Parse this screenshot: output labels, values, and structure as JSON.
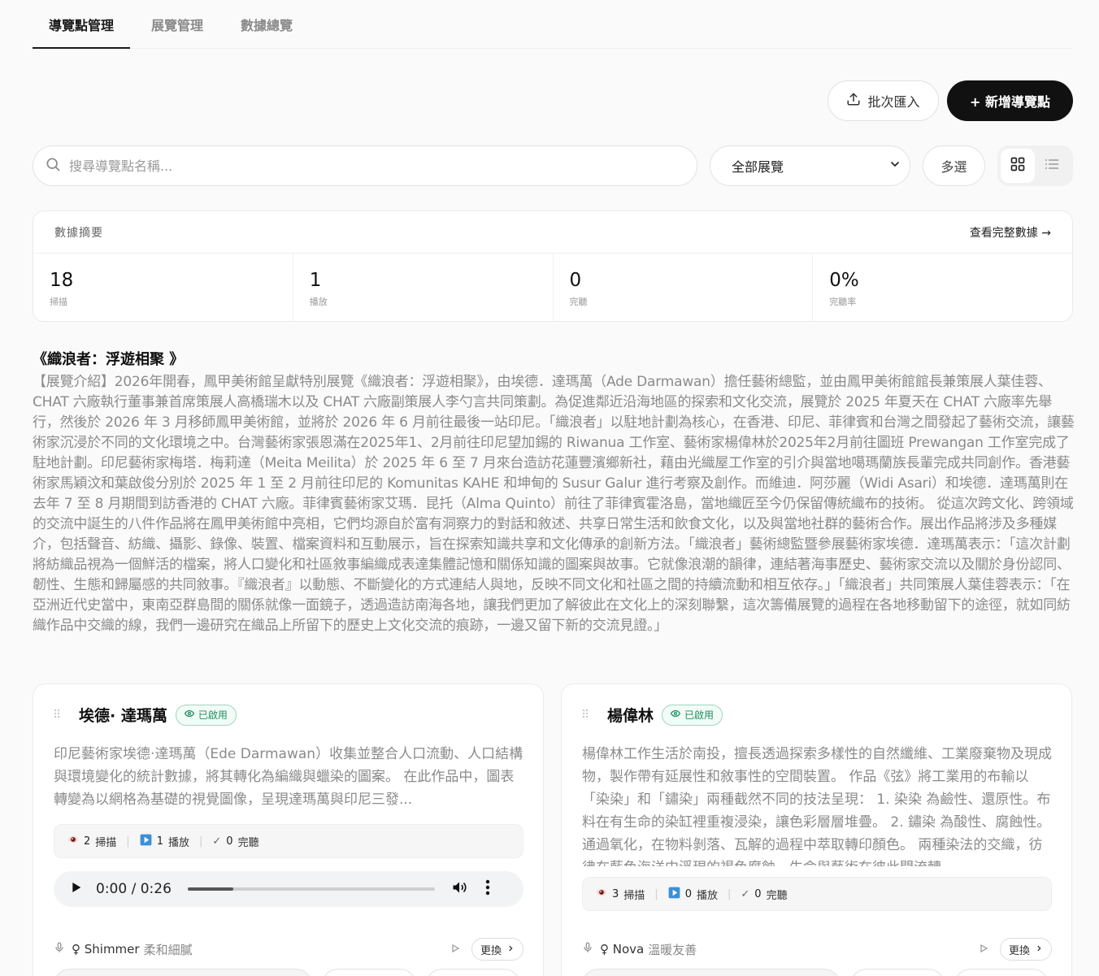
{
  "tabs": [
    {
      "label": "導覽點管理",
      "active": true
    },
    {
      "label": "展覽管理",
      "active": false
    },
    {
      "label": "數據總覽",
      "active": false
    }
  ],
  "actions": {
    "import_label": "批次匯入",
    "add_label": "+ 新增導覽點"
  },
  "filters": {
    "search_placeholder": "搜尋導覽點名稱...",
    "exhibition_select": "全部展覽",
    "multi_label": "多選",
    "view_mode": "grid"
  },
  "summary": {
    "title": "數據摘要",
    "link": "查看完整數據 →",
    "stats": [
      {
        "value": "18",
        "label": "掃描"
      },
      {
        "value": "1",
        "label": "播放"
      },
      {
        "value": "0",
        "label": "完聽"
      },
      {
        "value": "0%",
        "label": "完聽率"
      }
    ]
  },
  "exhibition": {
    "title": "《織浪者：浮遊相聚 》",
    "description": "【展覽介紹】2026年開春，鳳甲美術館呈獻特別展覽《織浪者：浮遊相聚》，由埃德．達瑪萬（Ade Darmawan）擔任藝術總監，並由鳳甲美術館館長兼策展人葉佳蓉、CHAT 六廠執行董事兼首席策展人高橋瑞木以及 CHAT 六廠副策展人李勺言共同策劃。為促進鄰近沿海地區的探索和文化交流，展覽於 2025 年夏天在 CHAT 六廠率先舉行，然後於 2026 年 3 月移師鳳甲美術館，並將於 2026 年 6 月前往最後一站印尼。「織浪者」以駐地計劃為核心，在香港、印尼、菲律賓和台灣之間發起了藝術交流，讓藝術家沉浸於不同的文化環境之中。台灣藝術家張恩滿在2025年1、2月前往印尼望加錫的 Riwanua 工作室、藝術家楊偉林於2025年2月前往圖班 Prewangan 工作室完成了駐地計劃。印尼藝術家梅塔．梅莉達（Meita Meilita）於 2025 年 6 至 7 月來台造訪花蓮豐濱鄉新社，藉由光織屋工作室的引介與當地噶瑪蘭族長輩完成共同創作。香港藝術家馬穎汶和葉啟俊分別於 2025 年 1 至 2 月前往印尼的 Komunitas KAHE 和坤甸的 Susur Galur 進行考察及創作。而維迪．阿莎麗（Widi Asari）和埃德．達瑪萬則在去年 7 至 8 月期間到訪香港的 CHAT 六廠。菲律賓藝術家艾瑪．昆托（Alma Quinto）前往了菲律賓霍洛島，當地織匠至今仍保留傳統織布的技術。 從這次跨文化、跨領域的交流中誕生的八件作品將在鳳甲美術館中亮相，它們均源自於富有洞察力的對話和敘述、共享日常生活和飲食文化，以及與當地社群的藝術合作。展出作品將涉及多種媒介，包括聲音、紡織、攝影、錄像、裝置、檔案資料和互動展示，旨在探索知識共享和文化傳承的創新方法。「織浪者」藝術總監暨參展藝術家埃德．達瑪萬表示：「這次計劃將紡織品視為一個鮮活的檔案，將人口變化和社區敘事編織成表達集體記憶和關係知識的圖案與故事。它就像浪潮的韻律，連結著海事歷史、藝術家交流以及關於身份認同、韌性、生態和歸屬感的共同敘事。『織浪者』以動態、不斷變化的方式連結人與地，反映不同文化和社區之間的持續流動和相互依存。」「織浪者」共同策展人葉佳蓉表示：「在亞洲近代史當中，東南亞群島間的關係就像一面鏡子，透過造訪南海各地，讓我們更加了解彼此在文化上的深刻聯繫，這次籌備展覽的過程在各地移動留下的途徑，就如同紡織作品中交織的線，我們一邊研究在織品上所留下的歷史上文化交流的痕跡，一邊又留下新的交流見證。」"
  },
  "cards": [
    {
      "name": "埃德· 達瑪萬",
      "status": "已啟用",
      "description": "印尼藝術家埃德·達瑪萬（Ede Darmawan）收集並整合人口流動、人口結構與環境變化的統計數據，將其轉化為編織與蠟染的圖案。 在此作品中，圖表轉變為以網格為基礎的視覺圖像，呈現達瑪萬與印尼三發...",
      "scans": "2",
      "scans_label": "掃描",
      "plays": "1",
      "plays_label": "播放",
      "completes": "0",
      "completes_label": "完聽",
      "audio_time": "0:00 / 0:26",
      "audio_progress": 0.0,
      "voice_name": "♀ Shimmer",
      "voice_desc": "柔和細膩",
      "change_label": "更換"
    },
    {
      "name": "楊偉林",
      "status": "已啟用",
      "description": "楊偉林工作生活於南投，擅長透過探索多樣性的自然纖維、工業廢棄物及現成物，製作帶有延展性和敘事性的空間裝置。 作品《弦》將工業用的布輸以「染染」和「鏽染」兩種截然不同的技法呈現： 1. 染染 為鹼性、還原性。布料在有生命的染缸裡重複浸染，讓色彩層層堆疊。 2. 鏽染 為酸性、腐蝕性。通過氧化，在物料剝落、瓦解的過程中萃取轉印顏色。 兩種染法的交織，彷彿在藍色海洋中浮現的褐色腐蝕，生命與藝術在彼此間流轉。",
      "scans": "3",
      "scans_label": "掃描",
      "plays": "0",
      "plays_label": "播放",
      "completes": "0",
      "completes_label": "完聽",
      "voice_name": "♀ Nova",
      "voice_desc": "溫暖友善",
      "change_label": "更換"
    }
  ],
  "colors": {
    "accent": "#111111",
    "status_green": "#1e8f62",
    "muted_text": "#8b8b8b"
  }
}
